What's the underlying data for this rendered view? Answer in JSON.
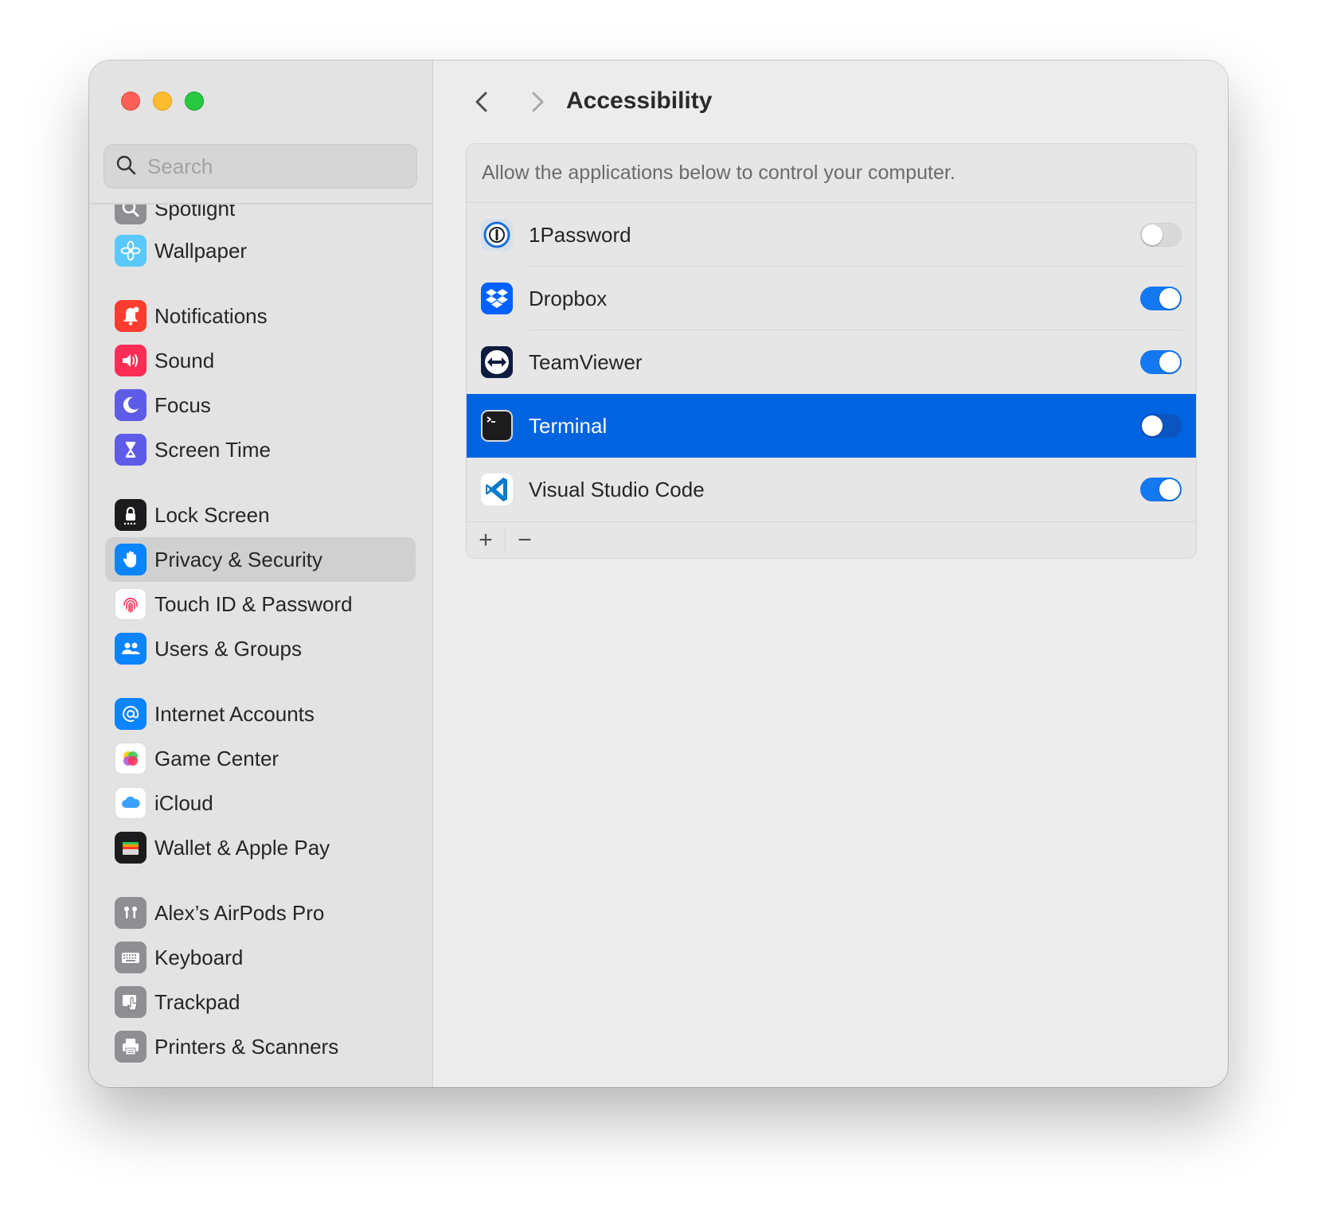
{
  "search": {
    "placeholder": "Search"
  },
  "sidebar": {
    "items": [
      {
        "label": "Spotlight",
        "icon": "spotlight-icon",
        "color": "#8e8e93"
      },
      {
        "label": "Wallpaper",
        "icon": "wallpaper-icon",
        "color": "#5ac8fa"
      },
      {
        "label": "Notifications",
        "icon": "bell-icon",
        "color": "#ff3b30"
      },
      {
        "label": "Sound",
        "icon": "speaker-icon",
        "color": "#ff2d55"
      },
      {
        "label": "Focus",
        "icon": "moon-icon",
        "color": "#5e5ce6"
      },
      {
        "label": "Screen Time",
        "icon": "hourglass-icon",
        "color": "#5e5ce6"
      },
      {
        "label": "Lock Screen",
        "icon": "lock-icon",
        "color": "#1c1c1e"
      },
      {
        "label": "Privacy & Security",
        "icon": "hand-icon",
        "color": "#0a84ff",
        "selected": true
      },
      {
        "label": "Touch ID & Password",
        "icon": "fingerprint-icon",
        "color": "#ffffff"
      },
      {
        "label": "Users & Groups",
        "icon": "users-icon",
        "color": "#0a84ff"
      },
      {
        "label": "Internet Accounts",
        "icon": "at-icon",
        "color": "#0a84ff"
      },
      {
        "label": "Game Center",
        "icon": "game-center-icon",
        "color": "#ffffff"
      },
      {
        "label": "iCloud",
        "icon": "cloud-icon",
        "color": "#ffffff"
      },
      {
        "label": "Wallet & Apple Pay",
        "icon": "wallet-icon",
        "color": "#1c1c1e"
      },
      {
        "label": "Alex’s AirPods Pro",
        "icon": "airpods-icon",
        "color": "#8e8e93"
      },
      {
        "label": "Keyboard",
        "icon": "keyboard-icon",
        "color": "#8e8e93"
      },
      {
        "label": "Trackpad",
        "icon": "trackpad-icon",
        "color": "#8e8e93"
      },
      {
        "label": "Printers & Scanners",
        "icon": "printer-icon",
        "color": "#8e8e93"
      }
    ]
  },
  "header": {
    "title": "Accessibility"
  },
  "panel": {
    "description": "Allow the applications below to control your computer.",
    "apps": [
      {
        "name": "1Password",
        "enabled": false,
        "selected": false,
        "icon": "1password-icon"
      },
      {
        "name": "Dropbox",
        "enabled": true,
        "selected": false,
        "icon": "dropbox-icon"
      },
      {
        "name": "TeamViewer",
        "enabled": true,
        "selected": false,
        "icon": "teamviewer-icon"
      },
      {
        "name": "Terminal",
        "enabled": false,
        "selected": true,
        "icon": "terminal-icon"
      },
      {
        "name": "Visual Studio Code",
        "enabled": true,
        "selected": false,
        "icon": "vscode-icon"
      }
    ],
    "add_label": "+",
    "remove_label": "−"
  },
  "colors": {
    "accent": "#0064e1",
    "toggle_on": "#1478f0",
    "close": "#fe5f57",
    "minimize": "#febc2e",
    "maximize": "#28c840"
  }
}
